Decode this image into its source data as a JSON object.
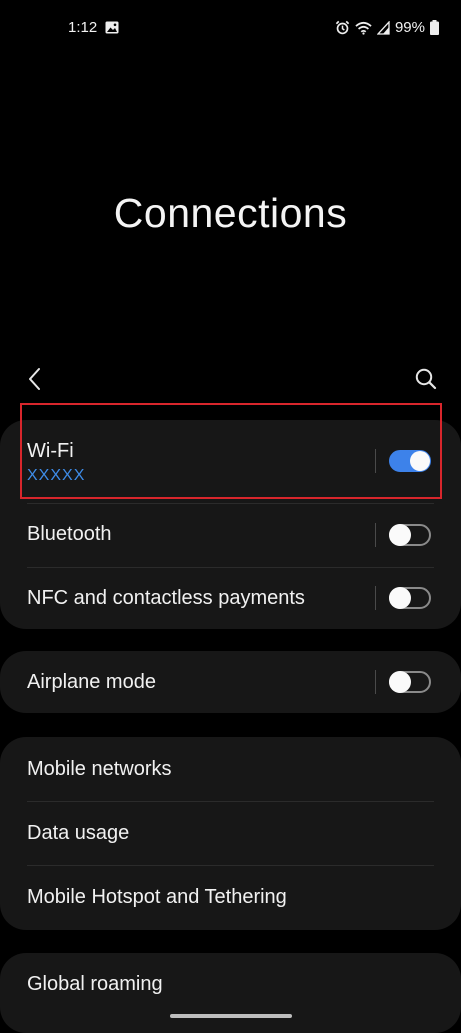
{
  "status_bar": {
    "time": "1:12",
    "battery": "99%",
    "icons": [
      "gallery-icon",
      "alarm-icon",
      "wifi-icon",
      "signal-icon",
      "battery-icon"
    ]
  },
  "header": {
    "title": "Connections",
    "back_icon": "chevron-left-icon",
    "search_icon": "search-icon"
  },
  "groups": [
    {
      "items": [
        {
          "label": "Wi-Fi",
          "sublabel": "XXXXX",
          "toggle": true
        },
        {
          "label": "Bluetooth",
          "toggle": false
        },
        {
          "label": "NFC and contactless payments",
          "toggle": false
        }
      ]
    },
    {
      "items": [
        {
          "label": "Airplane mode",
          "toggle": false
        }
      ]
    },
    {
      "items": [
        {
          "label": "Mobile networks"
        },
        {
          "label": "Data usage"
        },
        {
          "label": "Mobile Hotspot and Tethering"
        }
      ]
    },
    {
      "items": [
        {
          "label": "Global roaming"
        }
      ]
    }
  ],
  "colors": {
    "accent": "#3d82ea",
    "highlight": "#d8262c",
    "card": "#171717",
    "background": "#000000"
  }
}
